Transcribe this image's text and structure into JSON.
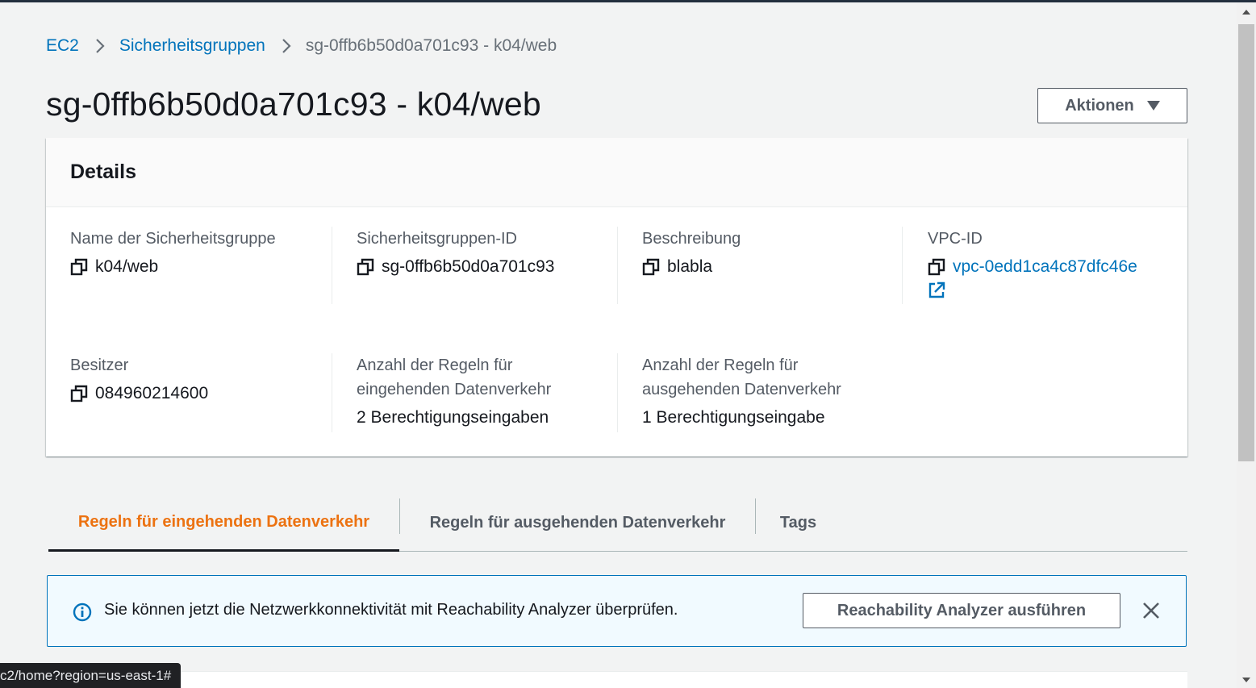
{
  "breadcrumb": {
    "items": [
      "EC2",
      "Sicherheitsgruppen"
    ],
    "current": "sg-0ffb6b50d0a701c93 - k04/web"
  },
  "page": {
    "title": "sg-0ffb6b50d0a701c93 - k04/web",
    "actions_label": "Aktionen"
  },
  "details": {
    "title": "Details",
    "fields": [
      {
        "label": "Name der Sicherheitsgruppe",
        "value": "k04/web",
        "copyable": true
      },
      {
        "label": "Sicherheitsgruppen-ID",
        "value": "sg-0ffb6b50d0a701c93",
        "copyable": true
      },
      {
        "label": "Beschreibung",
        "value": "blabla",
        "copyable": true
      },
      {
        "label": "VPC-ID",
        "value": "vpc-0edd1ca4c87dfc46e",
        "copyable": true,
        "link": true
      },
      {
        "label": "Besitzer",
        "value": "084960214600",
        "copyable": true
      },
      {
        "label": "Anzahl der Regeln für eingehenden Datenverkehr",
        "value": "2 Berechtigungseingaben",
        "copyable": false
      },
      {
        "label": "Anzahl der Regeln für ausgehenden Datenverkehr",
        "value": "1 Berechtigungseingabe",
        "copyable": false
      }
    ]
  },
  "tabs": [
    {
      "label": "Regeln für eingehenden Datenverkehr",
      "active": true
    },
    {
      "label": "Regeln für ausgehenden Datenverkehr",
      "active": false
    },
    {
      "label": "Tags",
      "active": false
    }
  ],
  "flash": {
    "message": "Sie können jetzt die Netzwerkkonnektivität mit Reachability Analyzer überprüfen.",
    "button_label": "Reachability Analyzer ausführen"
  },
  "status_bar": {
    "url": "c2/home?region=us-east-1#"
  },
  "colors": {
    "link": "#0073bb",
    "active_tab": "#ec7211",
    "text": "#16191f",
    "muted": "#545b64",
    "background": "#f2f3f3"
  },
  "icons": [
    "chevron-right-icon",
    "caret-down-icon",
    "copy-icon",
    "external-link-icon",
    "info-icon",
    "close-icon"
  ]
}
